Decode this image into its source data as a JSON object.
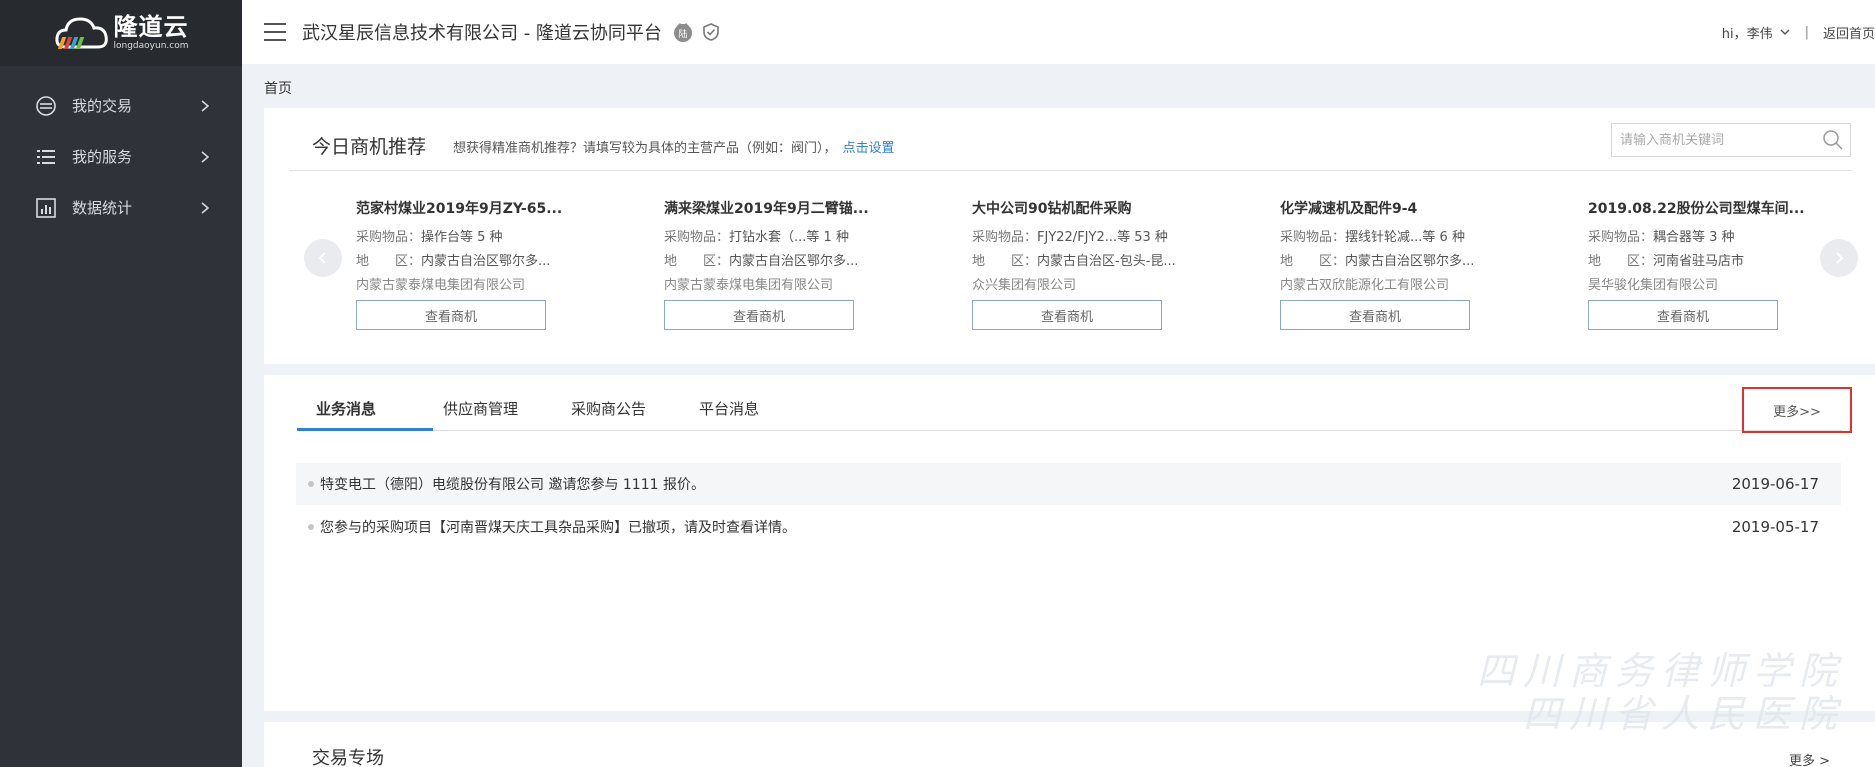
{
  "brand": {
    "name_cn": "隆道云",
    "name_en": "longdaoyun.com"
  },
  "sidebar": {
    "items": [
      {
        "label": "我的交易",
        "icon": "trade-icon"
      },
      {
        "label": "我的服务",
        "icon": "list-icon"
      },
      {
        "label": "数据统计",
        "icon": "chart-icon"
      }
    ]
  },
  "header": {
    "company": "武汉星辰信息技术有限公司 - 隆道云协同平台",
    "badge_text": "陆",
    "user": "hi，李伟",
    "separator": "|",
    "home_link": "返回首页"
  },
  "breadcrumb": "首页",
  "recommend": {
    "title": "今日商机推荐",
    "tip": "想获得精准商机推荐？请填写较为具体的主营产品（例如：阀门），",
    "tip_link": "点击设置",
    "search_placeholder": "请输入商机关键词",
    "label_goods": "采购物品：",
    "label_region": "地　　区：",
    "button_label": "查看商机",
    "items": [
      {
        "title": "范家村煤业2019年9月ZY-65...",
        "goods": "操作台等 5 种",
        "region": "内蒙古自治区鄂尔多...",
        "company": "内蒙古蒙泰煤电集团有限公司"
      },
      {
        "title": "满来梁煤业2019年9月二臂锚...",
        "goods": "打钻水套（...等 1 种",
        "region": "内蒙古自治区鄂尔多...",
        "company": "内蒙古蒙泰煤电集团有限公司"
      },
      {
        "title": "大中公司90钻机配件采购",
        "goods": "FJY22/FJY2...等 53 种",
        "region": "内蒙古自治区-包头-昆...",
        "company": "众兴集团有限公司"
      },
      {
        "title": "化学减速机及配件9-4",
        "goods": "摆线针轮减...等 6 种",
        "region": "内蒙古自治区鄂尔多...",
        "company": "内蒙古双欣能源化工有限公司"
      },
      {
        "title": "2019.08.22股份公司型煤车间...",
        "goods": "耦合器等 3 种",
        "region": "河南省驻马店市",
        "company": "昊华骏化集团有限公司"
      }
    ]
  },
  "messages": {
    "tabs": [
      "业务消息",
      "供应商管理",
      "采购商公告",
      "平台消息"
    ],
    "more_label": "更多>>",
    "items": [
      {
        "text": "特变电工（德阳）电缆股份有限公司 邀请您参与 1111 报价。",
        "date": "2019-06-17"
      },
      {
        "text": "您参与的采购项目【河南晋煤天庆工具杂品采购】已撤项，请及时查看详情。",
        "date": "2019-05-17"
      }
    ]
  },
  "trade": {
    "title": "交易专场",
    "more_label": "更多 >"
  },
  "watermark": [
    "四川商务律师学院",
    "四川省人民医院"
  ],
  "colors": {
    "sidebar_bg": "#2f3339",
    "accent": "#2f80d8",
    "highlight_border": "#e03030"
  }
}
